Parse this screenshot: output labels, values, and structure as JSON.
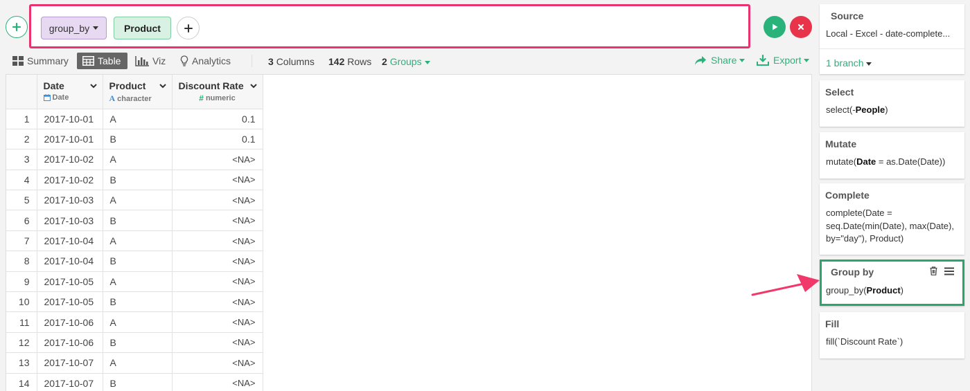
{
  "command": {
    "function_label": "group_by",
    "argument_label": "Product"
  },
  "view_tabs": [
    {
      "label": "Summary",
      "active": false
    },
    {
      "label": "Table",
      "active": true
    },
    {
      "label": "Viz",
      "active": false
    },
    {
      "label": "Analytics",
      "active": false
    }
  ],
  "stats": {
    "columns_count": "3",
    "columns_label": "Columns",
    "rows_count": "142",
    "rows_label": "Rows",
    "groups_count": "2",
    "groups_label": "Groups"
  },
  "actions": {
    "share_label": "Share",
    "export_label": "Export"
  },
  "table": {
    "columns": [
      {
        "name": "Date",
        "type": "Date",
        "type_icon": "calendar-icon"
      },
      {
        "name": "Product",
        "type": "character",
        "type_icon": "character-icon"
      },
      {
        "name": "Discount Rate",
        "type": "numeric",
        "type_icon": "hash-icon"
      }
    ],
    "rows": [
      {
        "idx": "1",
        "date": "2017-10-01",
        "product": "A",
        "discount": "0.1"
      },
      {
        "idx": "2",
        "date": "2017-10-01",
        "product": "B",
        "discount": "0.1"
      },
      {
        "idx": "3",
        "date": "2017-10-02",
        "product": "A",
        "discount": "<NA>"
      },
      {
        "idx": "4",
        "date": "2017-10-02",
        "product": "B",
        "discount": "<NA>"
      },
      {
        "idx": "5",
        "date": "2017-10-03",
        "product": "A",
        "discount": "<NA>"
      },
      {
        "idx": "6",
        "date": "2017-10-03",
        "product": "B",
        "discount": "<NA>"
      },
      {
        "idx": "7",
        "date": "2017-10-04",
        "product": "A",
        "discount": "<NA>"
      },
      {
        "idx": "8",
        "date": "2017-10-04",
        "product": "B",
        "discount": "<NA>"
      },
      {
        "idx": "9",
        "date": "2017-10-05",
        "product": "A",
        "discount": "<NA>"
      },
      {
        "idx": "10",
        "date": "2017-10-05",
        "product": "B",
        "discount": "<NA>"
      },
      {
        "idx": "11",
        "date": "2017-10-06",
        "product": "A",
        "discount": "<NA>"
      },
      {
        "idx": "12",
        "date": "2017-10-06",
        "product": "B",
        "discount": "<NA>"
      },
      {
        "idx": "13",
        "date": "2017-10-07",
        "product": "A",
        "discount": "<NA>"
      },
      {
        "idx": "14",
        "date": "2017-10-07",
        "product": "B",
        "discount": "<NA>"
      }
    ]
  },
  "steps": {
    "source": {
      "title": "Source",
      "body": "Local - Excel - date-complete...",
      "branch_label": "1 branch"
    },
    "select": {
      "title": "Select",
      "body_pre": "select(-",
      "body_bold": "People",
      "body_post": ")"
    },
    "mutate": {
      "title": "Mutate",
      "body_pre": "mutate(",
      "body_bold": "Date",
      "body_post": " = as.Date(Date))"
    },
    "complete": {
      "title": "Complete",
      "lines": [
        "complete(Date =",
        "seq.Date(min(Date), max(Date),",
        "by=\"day\"), Product)"
      ]
    },
    "group_by": {
      "title": "Group by",
      "body_pre": "group_by(",
      "body_bold": "Product",
      "body_post": ")"
    },
    "fill": {
      "title": "Fill",
      "body": "fill(`Discount Rate`)"
    }
  },
  "colors": {
    "accent_green": "#2ab27b",
    "highlight_pink": "#e8336e",
    "cancel_red": "#e8334a",
    "selected_step_border": "#2aa56b"
  }
}
